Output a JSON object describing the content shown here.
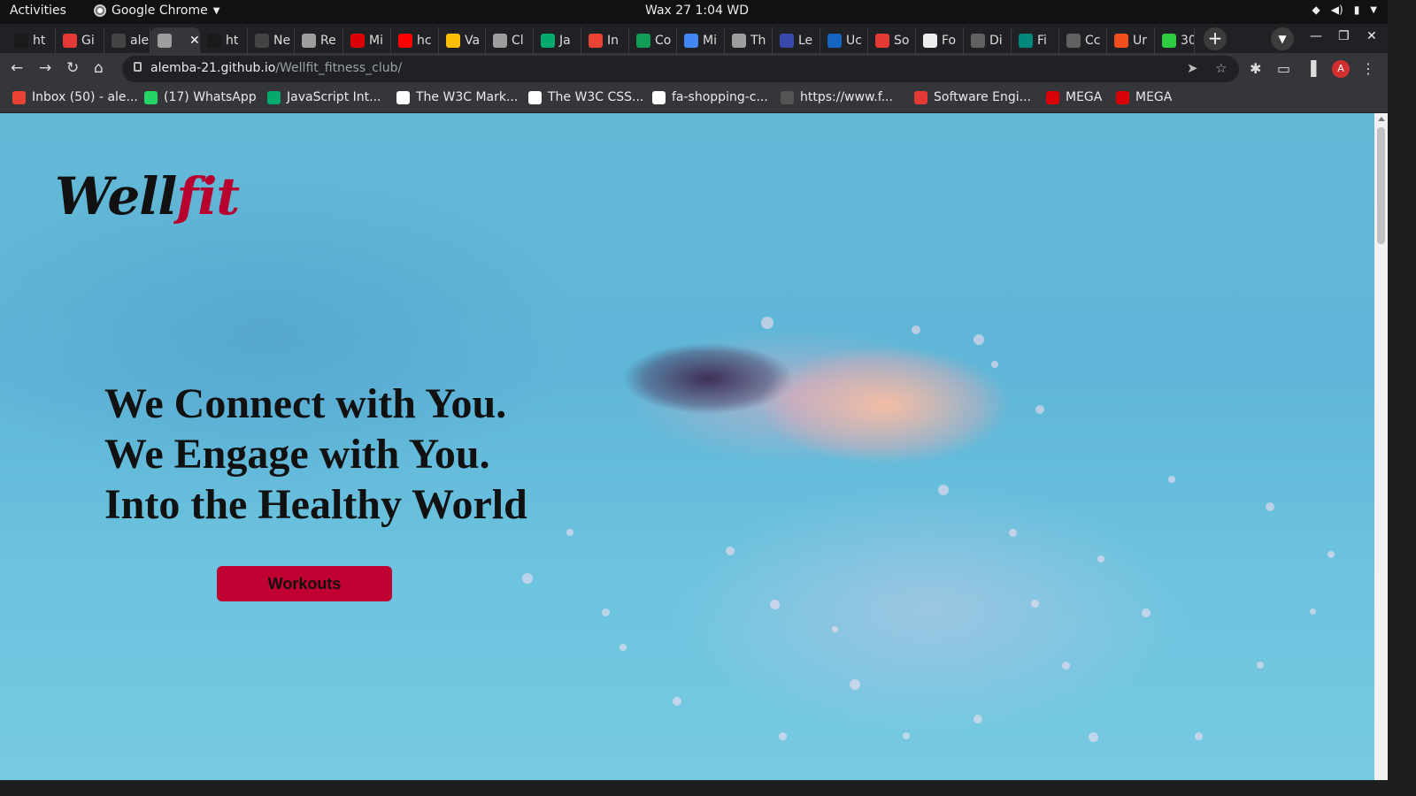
{
  "system_bar": {
    "activities": "Activities",
    "app_name": "Google Chrome",
    "clock": "Wax 27  1:04 WD"
  },
  "tabs": [
    {
      "label": "ht",
      "icon": "angular-icon",
      "color": "#1a1a1a"
    },
    {
      "label": "Gi",
      "icon": "red-ring-icon",
      "color": "#e53935"
    },
    {
      "label": "ale",
      "icon": "github-icon",
      "color": "#444"
    },
    {
      "label": "",
      "icon": "globe-icon",
      "color": "#9e9e9e",
      "active": true
    },
    {
      "label": "ht",
      "icon": "angular-icon",
      "color": "#1a1a1a"
    },
    {
      "label": "Ne",
      "icon": "github-icon",
      "color": "#444"
    },
    {
      "label": "Re",
      "icon": "globe-icon",
      "color": "#9e9e9e"
    },
    {
      "label": "Mi",
      "icon": "mega-icon",
      "color": "#d90007"
    },
    {
      "label": "hc",
      "icon": "youtube-icon",
      "color": "#ff0000"
    },
    {
      "label": "Va",
      "icon": "drive-icon",
      "color": "#fbbc04"
    },
    {
      "label": "Cl",
      "icon": "cloud-icon",
      "color": "#9e9e9e"
    },
    {
      "label": "Ja",
      "icon": "w3schools-icon",
      "color": "#04aa6d"
    },
    {
      "label": "In",
      "icon": "gmail-icon",
      "color": "#ea4335"
    },
    {
      "label": "Co",
      "icon": "sheets-icon",
      "color": "#0f9d58"
    },
    {
      "label": "Mi",
      "icon": "calendar-icon",
      "color": "#4285f4"
    },
    {
      "label": "Th",
      "icon": "octocat-icon",
      "color": "#9e9e9e"
    },
    {
      "label": "Le",
      "icon": "c-icon",
      "color": "#3949ab"
    },
    {
      "label": "Uc",
      "icon": "udemy-icon",
      "color": "#1565c0"
    },
    {
      "label": "So",
      "icon": "red-ring-icon",
      "color": "#e53935"
    },
    {
      "label": "Fo",
      "icon": "flag-icon",
      "color": "#eeeeee"
    },
    {
      "label": "Di",
      "icon": "p-icon",
      "color": "#616161"
    },
    {
      "label": "Fi",
      "icon": "chart-icon",
      "color": "#00897b"
    },
    {
      "label": "Cc",
      "icon": "dash-icon",
      "color": "#616161"
    },
    {
      "label": "Ur",
      "icon": "figma-icon",
      "color": "#f24e1e"
    },
    {
      "label": "30",
      "icon": "px-icon",
      "color": "#2ecc40"
    }
  ],
  "new_tab": "+",
  "address_bar": {
    "host": "alemba-21.github.io",
    "path": "/Wellfit_fitness_club/"
  },
  "avatar_letter": "A",
  "bookmarks": [
    {
      "label": "Inbox (50) - ale...",
      "icon": "gmail-icon",
      "color": "#ea4335"
    },
    {
      "label": "(17) WhatsApp",
      "icon": "whatsapp-icon",
      "color": "#25d366"
    },
    {
      "label": "JavaScript Int...",
      "icon": "w3schools-icon",
      "color": "#04aa6d"
    },
    {
      "label": "The W3C Mark...",
      "icon": "w3c-icon",
      "color": "#ffffff"
    },
    {
      "label": "The W3C CSS...",
      "icon": "w3c-css-icon",
      "color": "#ffffff"
    },
    {
      "label": "fa-shopping-c...",
      "icon": "flag-icon",
      "color": "#ffffff"
    },
    {
      "label": "https://www.f...",
      "icon": "angular-icon",
      "color": "#555"
    },
    {
      "label": "Software Engi...",
      "icon": "red-ring-icon",
      "color": "#e53935"
    },
    {
      "label": "MEGA",
      "icon": "mega-icon",
      "color": "#d90007"
    },
    {
      "label": "MEGA",
      "icon": "mega-icon",
      "color": "#d90007"
    }
  ],
  "page": {
    "logo_part1": "Well",
    "logo_part2": "fit",
    "headline_line1": "We Connect with You.",
    "headline_line2": "We Engage with You.",
    "headline_line3": "Into the Healthy World",
    "cta_label": "Workouts",
    "accent_color": "#bf0030"
  }
}
